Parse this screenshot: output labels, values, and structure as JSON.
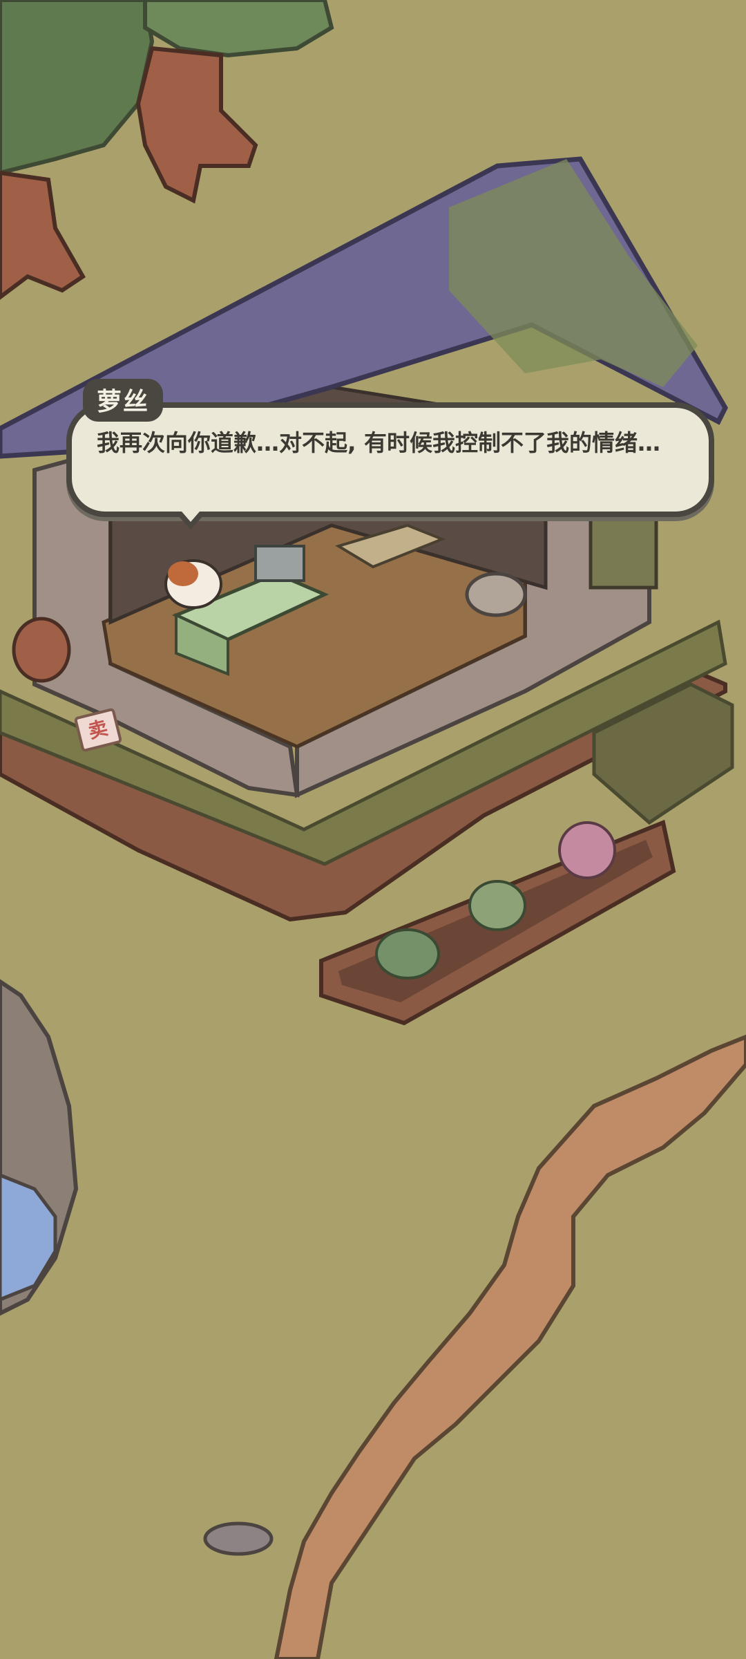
{
  "dialog": {
    "speaker": "萝丝",
    "text": "我再次向你道歉…对不起, 有时候我控制不了我的情绪…"
  },
  "shop_sign": "卖",
  "colors": {
    "grass": "#a9a06b",
    "path": "#bf8c67",
    "roof": "#6f6893",
    "wood": "#8a5a45",
    "water": "#8ea9d8",
    "dialog_bg": "#ece8d8",
    "dialog_border": "#4a4640"
  }
}
